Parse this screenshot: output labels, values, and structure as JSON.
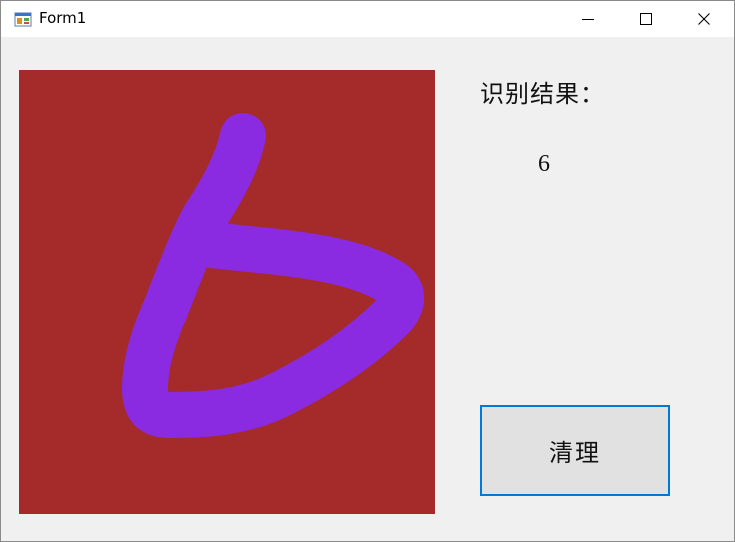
{
  "window": {
    "title": "Form1",
    "controls": {
      "minimize_icon": "minimize-icon",
      "maximize_icon": "maximize-icon",
      "close_icon": "close-icon"
    }
  },
  "canvas": {
    "background_color": "#a52a2a",
    "stroke_color": "#8a2be2",
    "drawn_content": "handwritten digit"
  },
  "result": {
    "label": "识别结果：",
    "value": "6"
  },
  "actions": {
    "clear_label": "清理"
  }
}
